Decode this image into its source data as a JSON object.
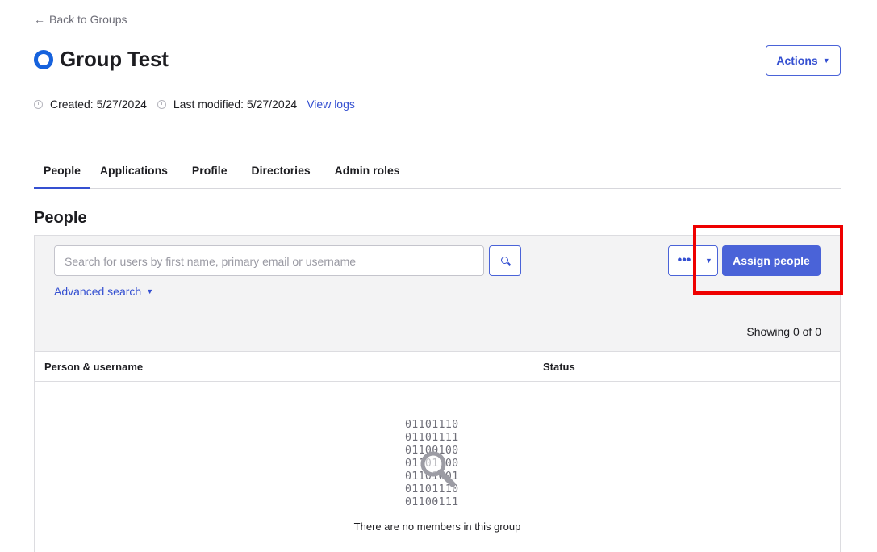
{
  "nav": {
    "back_label": "Back to Groups"
  },
  "header": {
    "title": "Group Test",
    "actions_label": "Actions"
  },
  "meta": {
    "created": "Created: 5/27/2024",
    "modified": "Last modified: 5/27/2024",
    "view_logs": "View logs"
  },
  "tabs": [
    {
      "label": "People",
      "active": true
    },
    {
      "label": "Applications"
    },
    {
      "label": "Profile"
    },
    {
      "label": "Directories"
    },
    {
      "label": "Admin roles"
    }
  ],
  "people": {
    "section_title": "People",
    "search": {
      "placeholder": "Search for users by first name, primary email or username"
    },
    "advanced_search": "Advanced search",
    "more_label": "•••",
    "assign_label": "Assign people",
    "showing": "Showing 0 of 0",
    "columns": [
      "Person & username",
      "Status"
    ],
    "empty": {
      "binary": [
        "01101110",
        "01101111",
        "01100100",
        "01101100",
        "01101001",
        "01101110",
        "01100111"
      ],
      "message": "There are no members in this group"
    }
  },
  "colors": {
    "accent": "#4a63d8",
    "link": "#3550d1",
    "group_icon": "#1662dd",
    "highlight": "#ee0000"
  },
  "icons": [
    "back-arrow-icon",
    "group-icon",
    "caret-down-icon",
    "clock-icon",
    "search-icon",
    "more-dots-icon",
    "magnifier-icon"
  ]
}
